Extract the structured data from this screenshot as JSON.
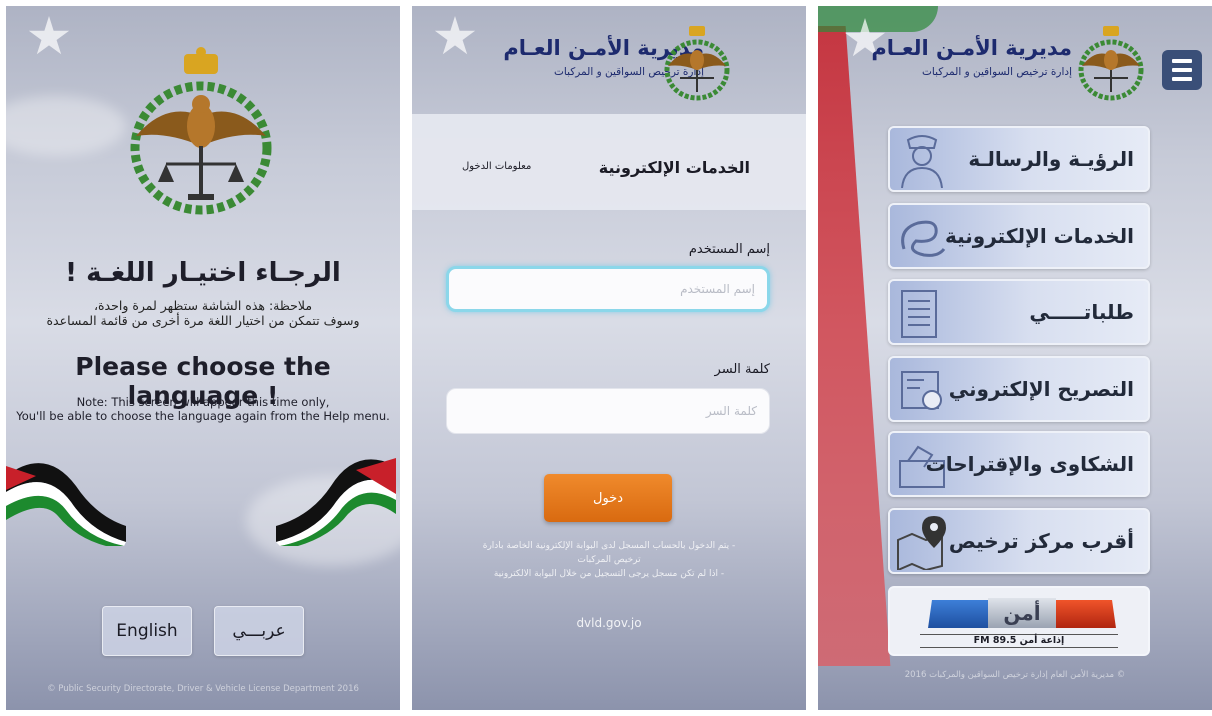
{
  "language_screen": {
    "arabic_title": "الرجـاء اختيـار اللغـة !",
    "arabic_note_line1": "ملاحظة: هذه الشاشة ستظهر لمرة واحدة،",
    "arabic_note_line2": "وسوف تتمكن من اختيار اللغة مرة أخرى من قائمة المساعدة",
    "english_title": "Please choose the language !",
    "english_note_line1": "Note: This screen will appear this time only,",
    "english_note_line2": "You'll be able to choose the language again from the Help menu.",
    "english_button": "English",
    "arabic_button": "عربـــي",
    "footer": "© Public Security Directorate, Driver & Vehicle License Department 2016"
  },
  "header": {
    "title": "مديرية الأمـن العـام",
    "subtitle": "إدارة ترخيص السواقين و المركبات"
  },
  "login_screen": {
    "tab_active": "الخدمات الإلكترونية",
    "tab_inactive": "معلومات الدخول",
    "username_label": "إسم المستخدم",
    "username_placeholder": "إسم المستخدم",
    "password_label": "كلمة السر",
    "password_placeholder": "كلمة السر",
    "login_button": "دخول",
    "hint_line1": "- يتم الدخول بالحساب المسجل لدى البوابة الإلكترونية الخاصة بادارة",
    "hint_line2": "ترخيص المركبات",
    "hint_line3": "- اذا لم تكن مسجل يرجى التسجيل من خلال البوابة الالكترونية",
    "link": "dvld.gov.jo"
  },
  "menu_screen": {
    "tiles": [
      {
        "label": "الرؤيـة والرسالـة",
        "icon": "officer-icon"
      },
      {
        "label": "الخدمات الإلكترونية",
        "icon": "e-service-icon"
      },
      {
        "label": "طلباتـــــي",
        "icon": "list-form-icon"
      },
      {
        "label": "التصريح الإلكتروني",
        "icon": "certificate-icon"
      },
      {
        "label": "الشكاوى والإقتراحات",
        "icon": "mailbox-icon"
      },
      {
        "label": "أقرب مركز ترخيص",
        "icon": "map-pin-icon"
      }
    ],
    "radio_logo": "أمن",
    "radio_caption": "إذاعة أمن 89.5 FM",
    "footer": "© مديرية الأمن العام إدارة ترخيص السواقين والمركبات 2016"
  },
  "colors": {
    "brand_blue": "#1d2a6e",
    "login_orange": "#e27a1e",
    "focus_cyan": "#8bd7ea",
    "menu_button": "#3a4f78"
  }
}
